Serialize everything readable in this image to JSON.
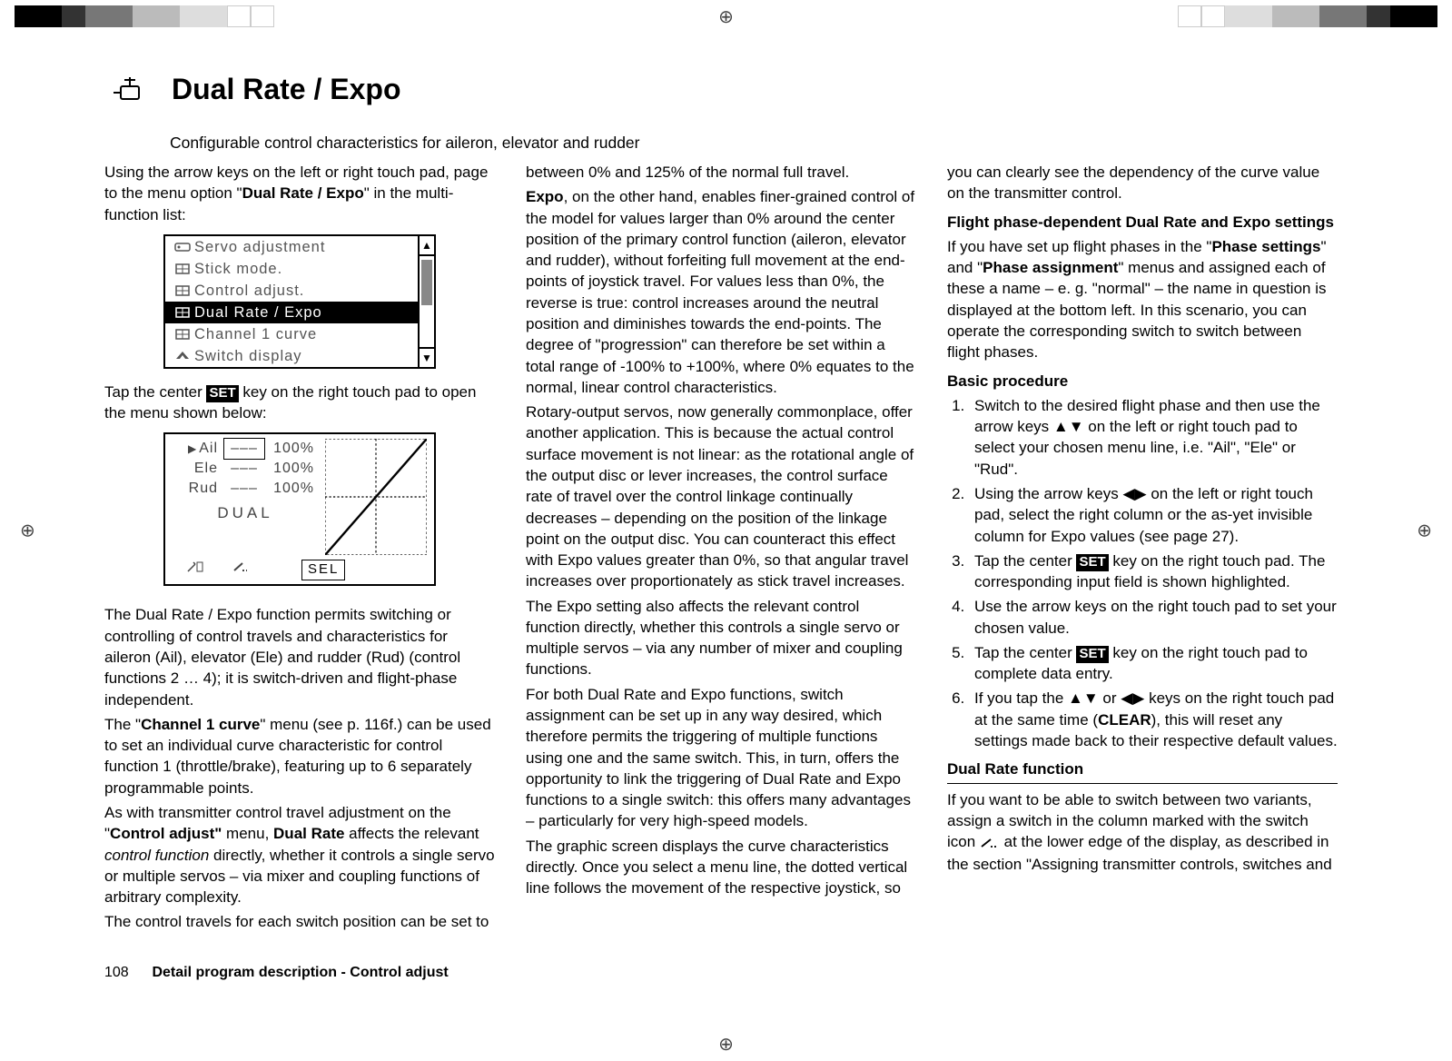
{
  "title": "Dual Rate / Expo",
  "subtitle": "Configurable control characteristics for aileron, elevator and rudder",
  "footer": {
    "page": "108",
    "text": "Detail program description - Control adjust"
  },
  "set_key": "SET",
  "menu": {
    "items": [
      {
        "icon": "servo",
        "label": "Servo adjustment"
      },
      {
        "icon": "stick",
        "label": "Stick mode."
      },
      {
        "icon": "stick",
        "label": "Control adjust."
      },
      {
        "icon": "stick",
        "label": "Dual Rate / Expo",
        "selected": true
      },
      {
        "icon": "stick",
        "label": "Channel 1 curve"
      },
      {
        "icon": "plane",
        "label": "Switch display"
      }
    ]
  },
  "curve": {
    "rows": [
      {
        "name": "Ail",
        "dash": "–––",
        "val": "100%",
        "sel": true,
        "boxed": true
      },
      {
        "name": "Ele",
        "dash": "–––",
        "val": "100%"
      },
      {
        "name": "Rud",
        "dash": "–––",
        "val": "100%"
      }
    ],
    "dual_label": "DUAL",
    "sel_label": "SEL"
  },
  "col1": {
    "p1a": "Using the arrow keys on the left or right touch pad, page to the menu option \"",
    "p1b": "Dual Rate / Expo",
    "p1c": "\" in the multi-function list:",
    "p2a": "Tap the center ",
    "p2b": " key on the right touch pad to open the menu shown below:",
    "p3": "The Dual Rate / Expo function permits switching or controlling of control travels and characteristics for aileron (Ail), elevator (Ele) and rudder (Rud) (control functions 2 … 4); it is switch-driven and flight-phase independent.",
    "p4a": "The \"",
    "p4b": "Channel 1 curve",
    "p4c": "\" menu (see p. 116f.) can be used to set an individual curve characteristic for control function 1 (throttle/brake), featuring up to 6 separately programmable points.",
    "p5a": "As with transmitter control travel adjustment on the \"",
    "p5b": "Control adjust\"",
    "p5c": " menu, ",
    "p5d": "Dual Rate",
    "p5e": " affects the relevant ",
    "p5f": "control function",
    "p5g": " directly, whether it controls a single servo or multiple servos – via mixer and coupling functions of arbitrary complexity.",
    "p6": "The control travels for each switch position can be set to"
  },
  "col2": {
    "p1": "between 0% and 125% of the normal full travel.",
    "p2a": "Expo",
    "p2b": ", on the other hand, enables finer-grained control of the model for values larger than 0% around the center position of the primary control function (aileron, elevator and rudder), without forfeiting full movement at the end-points of joystick travel. For values less than 0%, the reverse is true: control increases around the neutral position and diminishes towards the end-points. The degree of \"progression\" can therefore be set within a total range of -100% to +100%, where 0% equates to the normal, linear control characteristics.",
    "p3": "Rotary-output servos, now generally commonplace, offer another application. This is because the actual control surface movement is not linear: as the rotational angle of the output disc or lever increases, the control surface rate of travel over the control linkage continually decreases – depending on the position of the linkage point on the output disc.  You can counteract this effect with Expo values greater than 0%, so that angular travel increases over proportionately as stick travel increases.",
    "p4": "The Expo setting also affects the relevant control function directly, whether this controls a single servo or multiple servos – via any number of mixer and coupling functions.",
    "p5": "For both Dual Rate and Expo functions, switch assignment can be set up in any way desired, which therefore permits the triggering of multiple functions using one and the same switch. This, in turn, offers the opportunity to link the triggering of Dual Rate and Expo functions to a single switch: this offers many advantages – particularly for very high-speed models.",
    "p6": "The graphic screen displays the curve characteristics directly. Once you select a menu line, the dotted vertical line follows the movement of the respective joystick, so"
  },
  "col3": {
    "p1": "you can clearly see the dependency of the curve value on the transmitter control.",
    "h1": "Flight phase-dependent Dual Rate and Expo settings",
    "p2a": "If you have set up flight phases in the \"",
    "p2b": "Phase settings",
    "p2c": "\" and \"",
    "p2d": "Phase assignment",
    "p2e": "\" menus and assigned each of these a name – e. g. \"normal\" – the name in question is displayed at the bottom left. In this scenario, you can operate the corresponding switch to switch between flight phases.",
    "h2": "Basic procedure",
    "steps": [
      "Switch to the desired flight phase and then use the arrow keys ▲▼ on the left or right touch pad to select your chosen menu line, i.e. \"Ail\", \"Ele\" or \"Rud\".",
      "Using the arrow keys ◀▶ on the left or right touch pad, select the right column or the as-yet invisible column for Expo values (see page 27).",
      "Tap the center |SET| key on the right touch pad. The corresponding input field is shown highlighted.",
      "Use the arrow keys on the right touch pad to set your chosen value.",
      "Tap the center |SET| key on the right touch pad to complete data entry.",
      "If you tap the ▲▼ or ◀▶ keys on the right touch pad at the same time (|CLEAR|), this will reset any settings made back to their respective default values."
    ],
    "clear_key": "CLEAR",
    "h3": "Dual Rate function",
    "p3a": "If you want to be able to switch between two variants, assign a switch in the column marked with the switch icon ",
    "p3b": " at the lower edge of the display, as described in the section \"Assigning transmitter controls, switches and"
  }
}
